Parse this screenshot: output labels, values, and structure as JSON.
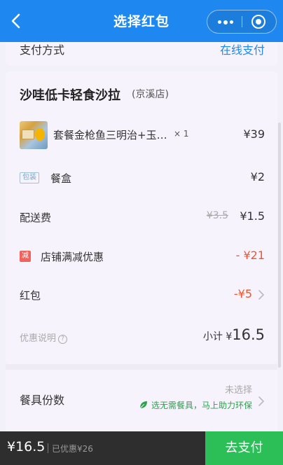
{
  "header": {
    "title": "选择红包"
  },
  "payment": {
    "label": "支付方式",
    "value": "在线支付"
  },
  "shop": {
    "name": "沙哇低卡轻食沙拉",
    "branch": "(京溪店)"
  },
  "items": [
    {
      "name": "套餐金枪鱼三明治+玉…",
      "qty": "× 1",
      "price": "¥39"
    }
  ],
  "packaging": {
    "tag": "包装",
    "label": "餐盒",
    "price": "¥2"
  },
  "delivery": {
    "label": "配送费",
    "original": "¥3.5",
    "price": "¥1.5"
  },
  "discount": {
    "icon": "减",
    "label": "店铺满减优惠",
    "value": "- ¥21"
  },
  "red_packet": {
    "label": "红包",
    "value": "-¥5"
  },
  "summary": {
    "explain": "优惠说明",
    "help": "?",
    "subtotal_label": "小计 ¥",
    "subtotal_value": "16.5"
  },
  "tableware": {
    "label": "餐具份数",
    "status": "未选择",
    "eco_text": "选无需餐具，马上助力环保"
  },
  "footer": {
    "price": "¥16.5",
    "saved": "已优惠¥26",
    "pay_button": "去支付"
  },
  "colors": {
    "primary": "#1f88f0",
    "accent_red": "#f0552d",
    "pay_green": "#2cbf58",
    "eco_green": "#2aa34a"
  }
}
